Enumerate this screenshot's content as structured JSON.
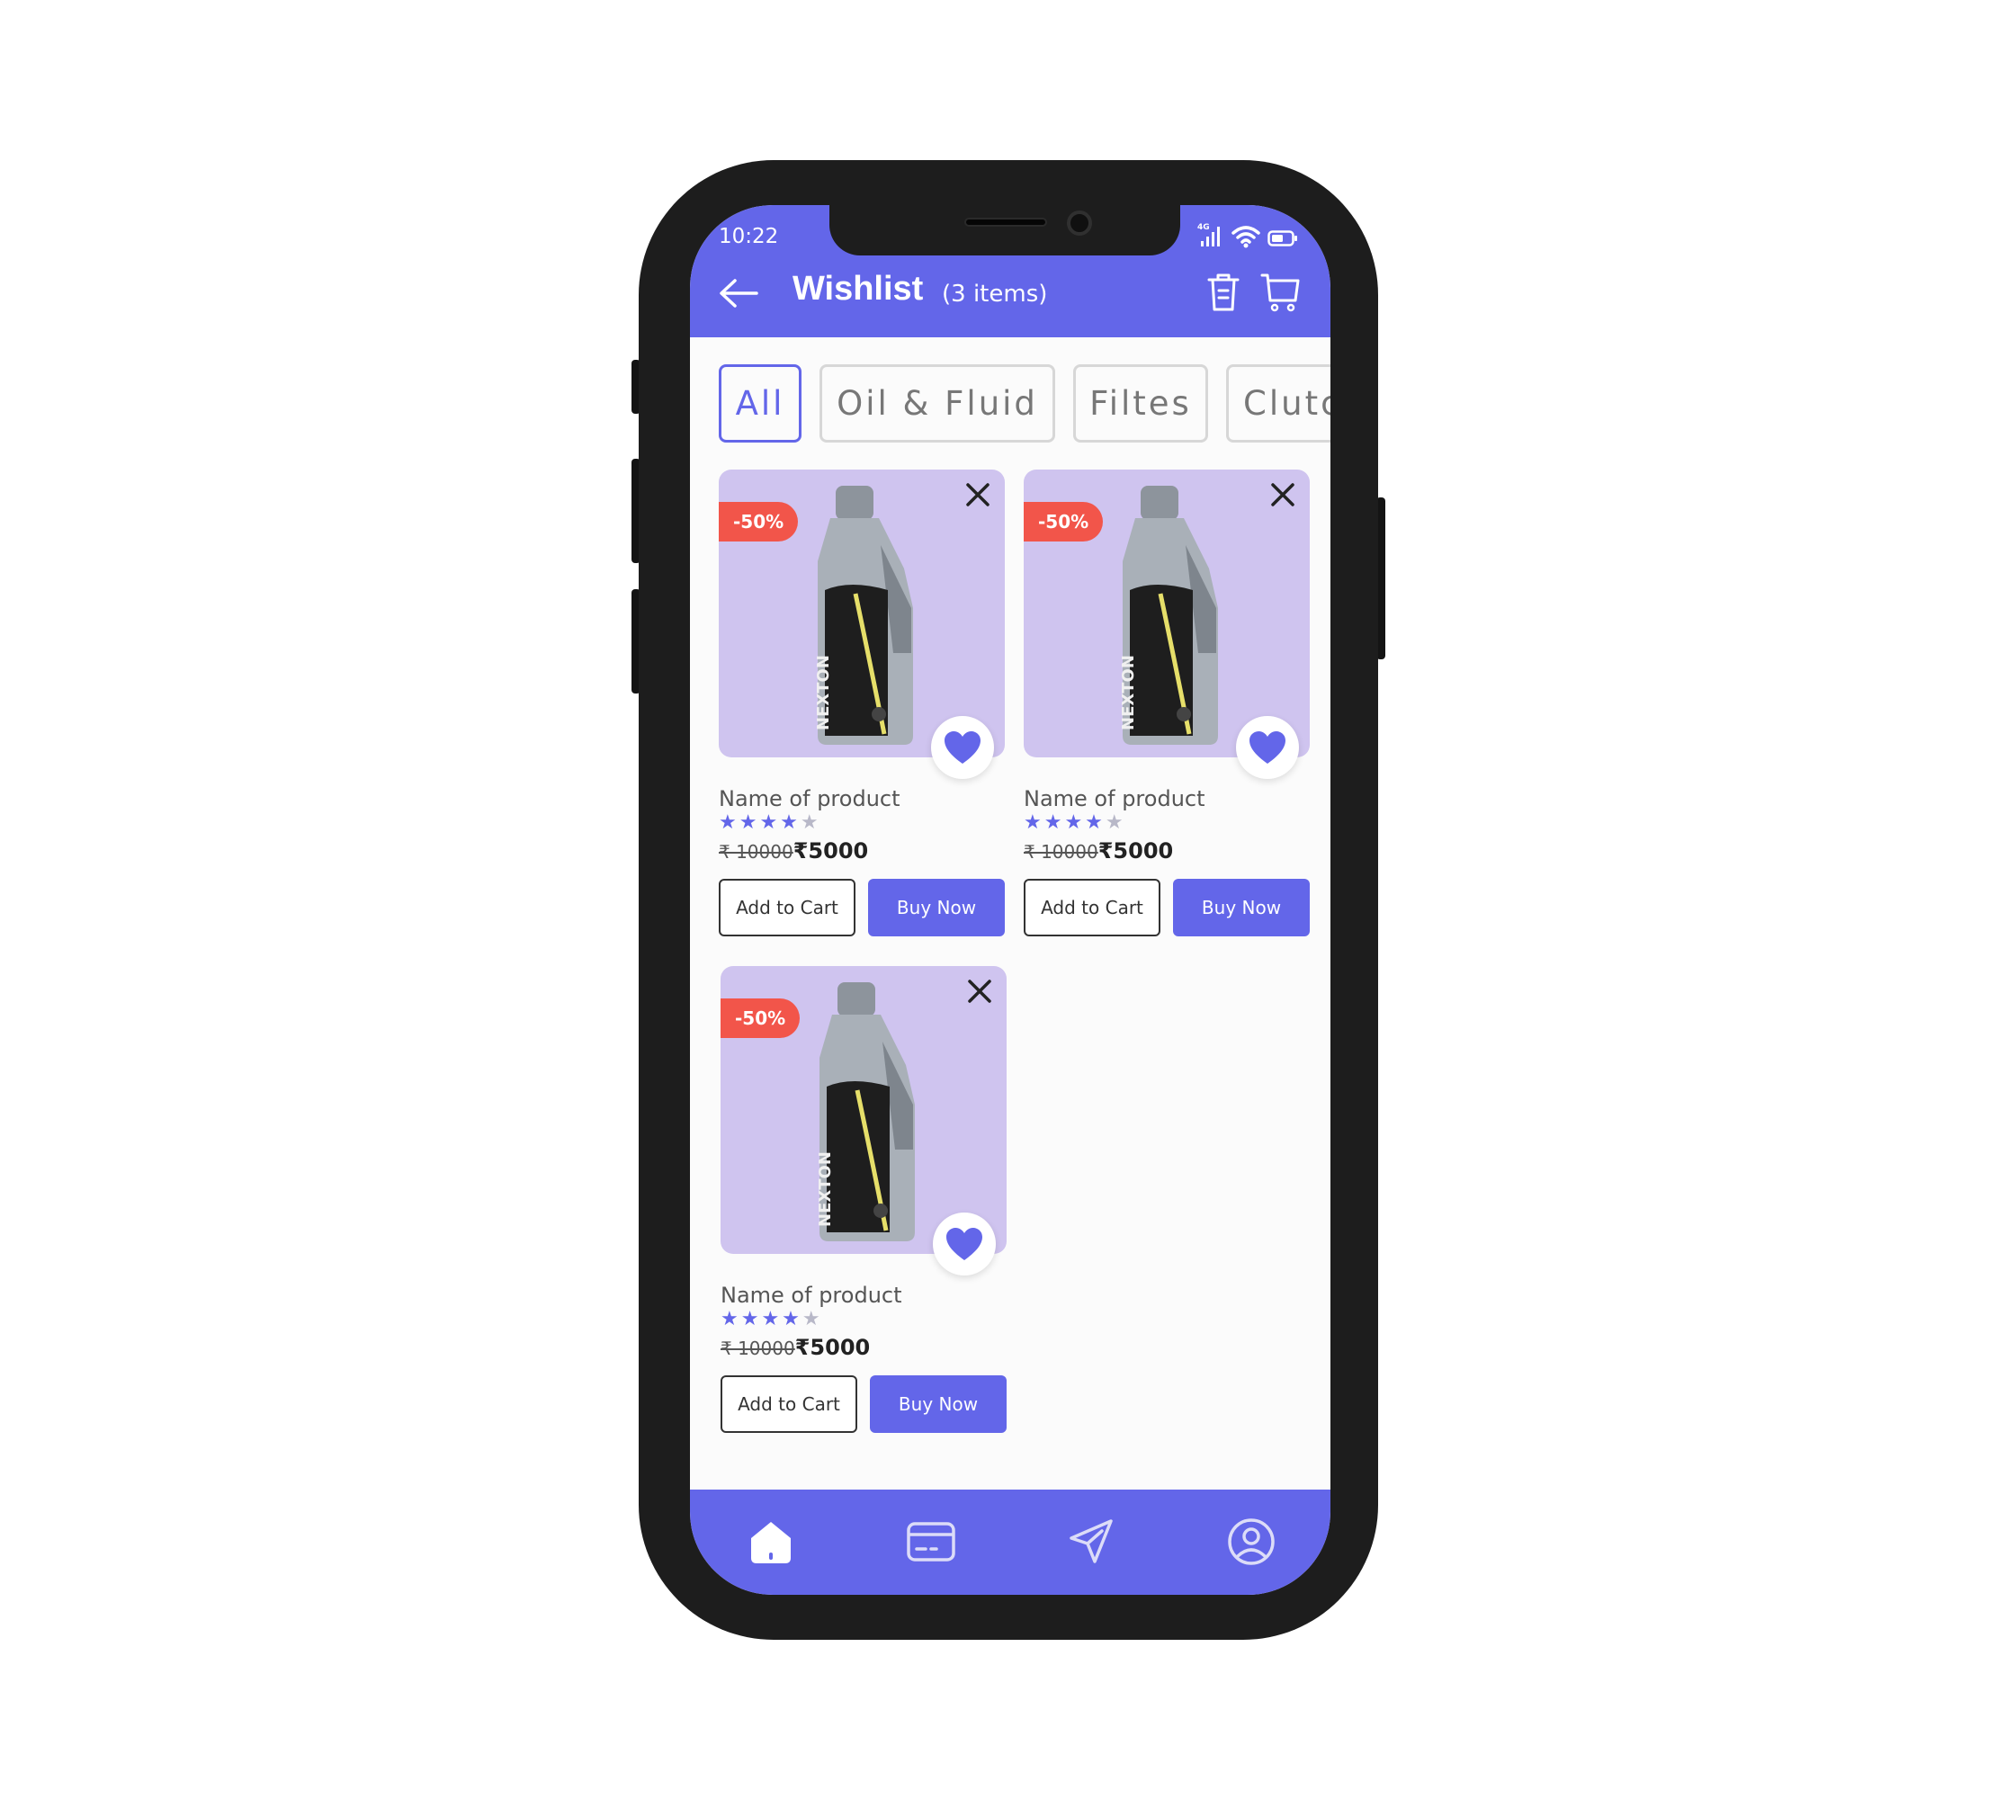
{
  "status": {
    "time": "10:22",
    "network": "4G"
  },
  "header": {
    "title": "Wishlist",
    "count": "(3 items)"
  },
  "chips": [
    {
      "label": "All"
    },
    {
      "label": "Oil & Fluid"
    },
    {
      "label": "Filtes"
    },
    {
      "label": "Clutc"
    }
  ],
  "products": [
    {
      "discount": "-50%",
      "name": "Name of product",
      "rating": 4,
      "old_price": "₹ 10000",
      "new_price": "₹5000",
      "add_label": "Add to Cart",
      "buy_label": "Buy Now"
    },
    {
      "discount": "-50%",
      "name": "Name of product",
      "rating": 4,
      "old_price": "₹ 10000",
      "new_price": "₹5000",
      "add_label": "Add to Cart",
      "buy_label": "Buy Now"
    },
    {
      "discount": "-50%",
      "name": "Name of product",
      "rating": 4,
      "old_price": "₹ 10000",
      "new_price": "₹5000",
      "add_label": "Add to Cart",
      "buy_label": "Buy Now"
    }
  ],
  "nav": [
    {
      "icon": "home-icon"
    },
    {
      "icon": "card-icon"
    },
    {
      "icon": "send-icon"
    },
    {
      "icon": "profile-icon"
    }
  ],
  "colors": {
    "primary": "#6366e9",
    "badge": "#f2554a",
    "card_bg": "#cfc4ef"
  }
}
